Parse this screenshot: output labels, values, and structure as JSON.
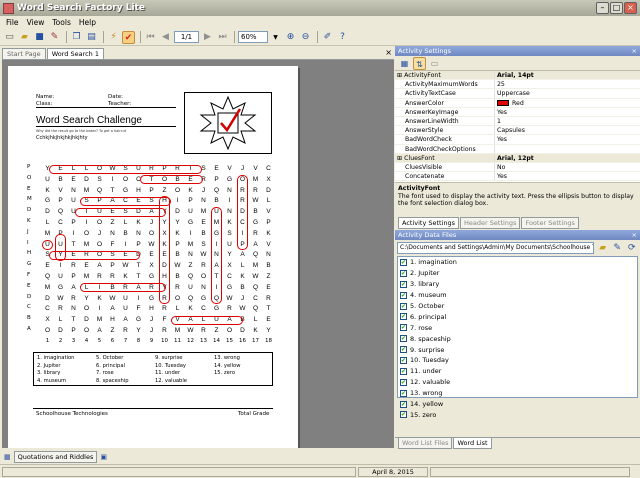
{
  "app": {
    "title": "Word Search Factory Lite"
  },
  "menu": [
    "File",
    "View",
    "Tools",
    "Help"
  ],
  "toolbar": {
    "page": "1/1",
    "zoom": "60%"
  },
  "tabs": [
    {
      "label": "Start Page",
      "active": false
    },
    {
      "label": "Word Search 1",
      "active": true
    }
  ],
  "document": {
    "name_label": "Name:",
    "date_label": "Date:",
    "class_label": "Class:",
    "teacher_label": "Teacher:",
    "title": "Word Search Challenge",
    "subtitle": "Why did the result go to the baker? To get a haircut",
    "scramble": "Cchkjhkjhkjhkjhkjhty",
    "row_labels": [
      "P",
      "O",
      "E",
      "M",
      "D",
      "K",
      "J",
      "I",
      "H",
      "G",
      "F",
      "E",
      "D",
      "C",
      "B",
      "A"
    ],
    "col_labels": [
      "1",
      "2",
      "3",
      "4",
      "5",
      "6",
      "7",
      "8",
      "9",
      "10",
      "11",
      "12",
      "13",
      "14",
      "15",
      "16",
      "17",
      "18"
    ],
    "grid": [
      "YELLOWSURPRISEVJVC",
      "UBEDSIOCTOBERPGOMX",
      "KVNMQTGHPZOKJQNRRD",
      "GPUSPACESHIPNBIRWL",
      "DQUTUESDAYDUMUNDBV",
      "LCPIOZLKJYYGEMKCGP",
      "MPIOJNBNOXKIBGSIRK",
      "UUTMOFIPWKPMSIUPAV",
      "SYEROSEDEEBNWNYAQN",
      "EIREAPWTXDWZRAXLMB",
      "QUPMRRKTGHBQOTCKWZ",
      "MGALIBRARYRUNIGBQE",
      "DWRYKWUIGROQGQWJCR",
      "CRNOIAUFHRLKCGRWQT",
      "XLTDMHAGJFVALUABLE",
      "ODPOAZRYJRMWRZODKY"
    ],
    "words": [
      "1. imagination",
      "2. Jupiter",
      "3. library",
      "4. museum",
      "5. October",
      "6. principal",
      "7. rose",
      "8. spaceship",
      "9. surprise",
      "10. Tuesday",
      "11. under",
      "12. valuable",
      "13. wrong",
      "14. yellow",
      "15. zero"
    ],
    "footer_left": "Schoolhouse Technologies",
    "footer_right": "Total Grade"
  },
  "activity_settings": {
    "header": "Activity Settings",
    "rows": [
      {
        "name": "ActivityFont",
        "value": "Arial, 14pt",
        "cat": true
      },
      {
        "name": "ActivityMaximumWords",
        "value": "25"
      },
      {
        "name": "ActivityTextCase",
        "value": "Uppercase"
      },
      {
        "name": "AnswerColor",
        "value": "Red",
        "swatch": "#e00000"
      },
      {
        "name": "AnswerKeyImage",
        "value": "Yes"
      },
      {
        "name": "AnswerLineWidth",
        "value": "1"
      },
      {
        "name": "AnswerStyle",
        "value": "Capsules"
      },
      {
        "name": "BadWordCheck",
        "value": "Yes"
      },
      {
        "name": "BadWordCheckOptions",
        "value": ""
      },
      {
        "name": "CluesFont",
        "value": "Arial, 12pt",
        "cat": true
      },
      {
        "name": "CluesVisible",
        "value": "No"
      },
      {
        "name": "Concatenate",
        "value": "Yes"
      }
    ],
    "desc_title": "ActivityFont",
    "desc_text": "The font used to display the activity text. Press the ellipsis button to display the font selection dialog box.",
    "tabs": [
      "Activity Settings",
      "Header Settings",
      "Footer Settings"
    ]
  },
  "data_files": {
    "header": "Activity Data Files",
    "path": "C:\\Documents and Settings\\Admin\\My Documents\\Schoolhouse Technologies",
    "items": [
      "1. imagination",
      "2. Jupiter",
      "3. library",
      "4. museum",
      "5. October",
      "6. principal",
      "7. rose",
      "8. spaceship",
      "9. surprise",
      "10. Tuesday",
      "11. under",
      "12. valuable",
      "13. wrong",
      "14. yellow",
      "15. zero"
    ],
    "tabs": [
      "Word List Files",
      "Word List"
    ]
  },
  "bottom": {
    "quotes": "Quotations and Riddles",
    "date": "April 8, 2015"
  }
}
